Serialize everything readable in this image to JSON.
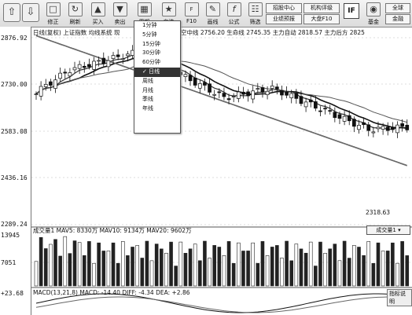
{
  "toolbar": {
    "buttons": [
      {
        "label": "",
        "icon": "left-arrow-icon"
      },
      {
        "label": "",
        "icon": "right-arrow-icon"
      },
      {
        "label": "修正",
        "icon": "edit-icon"
      },
      {
        "label": "刷新",
        "icon": "refresh-icon"
      },
      {
        "label": "买入",
        "icon": "buy-icon"
      },
      {
        "label": "卖出",
        "icon": "sell-icon"
      },
      {
        "label": "周期",
        "icon": "period-icon"
      },
      {
        "label": "自选",
        "icon": "favorite-icon"
      },
      {
        "label": "F10",
        "icon": "f10-icon"
      },
      {
        "label": "画线",
        "icon": "draw-line-icon"
      },
      {
        "label": "公式",
        "icon": "formula-icon"
      },
      {
        "label": "筛选",
        "icon": "filter-icon"
      }
    ],
    "quick_buttons": [
      "招股中心",
      "机构评级",
      "业绩预报",
      "大盘F10"
    ],
    "logo": "IF",
    "fund_label": "基金",
    "full_label": "全球",
    "prev_label": "金融"
  },
  "chart_header": {
    "title": "日线(复权)",
    "index_name": "上证指数",
    "system": "均线系统",
    "extra": "现",
    "ma_fragment": "空中线",
    "ma_value1": "2756.20",
    "ma_label2": "生命线",
    "ma_value2": "2745.35",
    "ma_label3": "主力自动",
    "ma_value3": "2818.57",
    "ma_label4": "主力后方",
    "ma_value4": "2825"
  },
  "price_axis": {
    "labels": [
      "2876.92",
      "2730.00",
      "2583.08",
      "2436.16",
      "2289.24"
    ]
  },
  "volume_axis": {
    "labels": [
      "13945",
      "7051"
    ]
  },
  "macd_axis": {
    "labels": [
      "+23.68"
    ]
  },
  "period_menu": {
    "items": [
      "1分钟",
      "5分钟",
      "15分钟",
      "30分钟",
      "60分钟",
      "日线",
      "周线",
      "月线",
      "季线",
      "年线"
    ],
    "selected_index": 5
  },
  "annotations": {
    "low_price": "2318.63"
  },
  "volume_header": {
    "title": "成交量1",
    "mav5": "MAV5: 8330万",
    "mav10": "MAV10: 9134万",
    "mav20": "MAV20: 9602万",
    "selector": "成交量1"
  },
  "macd_header": {
    "title": "MACD(13,21,8)",
    "macd": "MACD: -14.40",
    "diff": "DIFF: -4.34",
    "dea": "DEA: +2.86",
    "corner": "指标说明"
  },
  "chart_data": [
    {
      "type": "candlestick",
      "title": "",
      "ylim": [
        2289.24,
        2876.92
      ],
      "y_ticks": [
        2876.92,
        2730.0,
        2583.08,
        2436.16,
        2289.24
      ],
      "n": 78,
      "low_annotation": 2318.63
    },
    {
      "type": "bar",
      "title": "",
      "ylim": [
        0,
        13945
      ],
      "y_ticks": [
        13945,
        7051
      ]
    },
    {
      "type": "line",
      "title": "",
      "y_ticks": [
        23.68
      ]
    }
  ]
}
